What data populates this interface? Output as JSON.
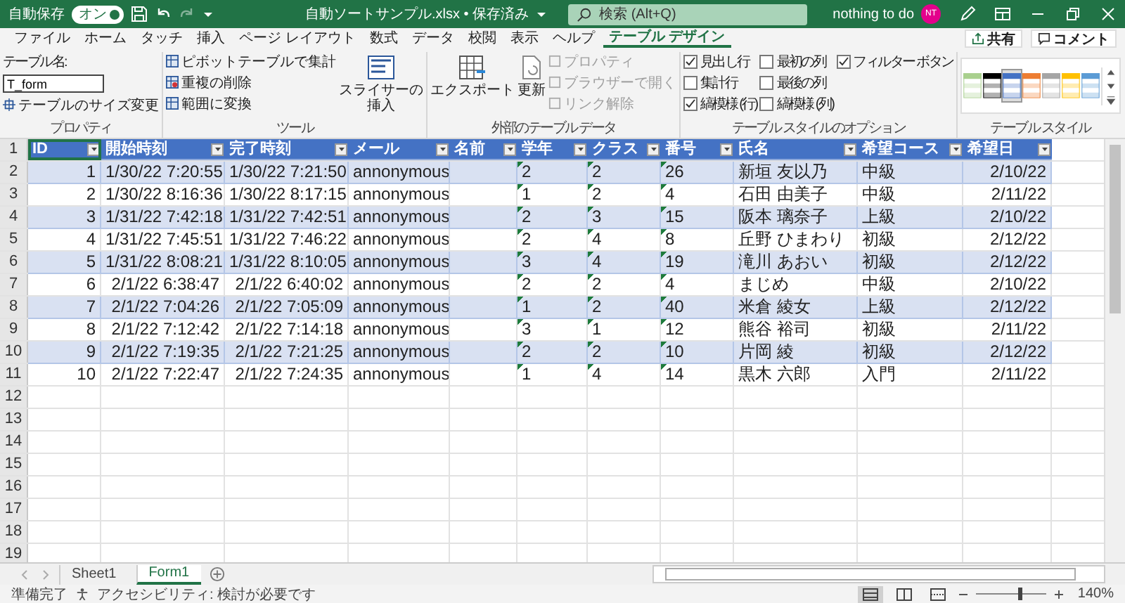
{
  "title_bar": {
    "autosave_label": "自動保存",
    "autosave": {
      "label": "オン",
      "on": true
    },
    "title": "自動ソートサンプル.xlsx • 保存済み",
    "search_placeholder": "検索 (Alt+Q)",
    "user": "nothing to do",
    "avatar": "NT"
  },
  "ribbon_tabs": [
    {
      "label": "ファイル",
      "selected": false
    },
    {
      "label": "ホーム",
      "selected": false
    },
    {
      "label": "タッチ",
      "selected": false
    },
    {
      "label": "挿入",
      "selected": false
    },
    {
      "label": "ページ レイアウト",
      "selected": false
    },
    {
      "label": "数式",
      "selected": false
    },
    {
      "label": "データ",
      "selected": false
    },
    {
      "label": "校閲",
      "selected": false
    },
    {
      "label": "表示",
      "selected": false
    },
    {
      "label": "ヘルプ",
      "selected": false
    },
    {
      "label": "テーブル デザイン",
      "selected": true
    }
  ],
  "share": "共有",
  "comment": "コメント",
  "properties": {
    "name_label": "テーブル名:",
    "name_value": "T_form",
    "resize": "テーブルのサイズ変更",
    "label": "プロパティ"
  },
  "tools": {
    "items": [
      "ピボットテーブルで集計",
      "重複の削除",
      "範囲に変換"
    ],
    "slicer_lines": [
      "スライサーの",
      "挿入"
    ],
    "label": "ツール"
  },
  "external": {
    "export": "エクスポート",
    "refresh": "更新",
    "links": [
      {
        "label": "プロパティ",
        "disabled": true
      },
      {
        "label": "ブラウザーで開く",
        "disabled": true
      },
      {
        "label": "リンク解除",
        "disabled": true
      }
    ],
    "label": "外部のテーブル データ"
  },
  "style_options": {
    "options": [
      {
        "label": "見出し行",
        "checked": true
      },
      {
        "label": "集計行",
        "checked": false
      },
      {
        "label": "縞模様 (行)",
        "checked": true
      },
      {
        "label": "最初の列",
        "checked": false
      },
      {
        "label": "最後の列",
        "checked": false
      },
      {
        "label": "縞模様 (列)",
        "checked": false
      },
      {
        "label": "フィルター ボタン",
        "checked": true
      }
    ],
    "label": "テーブル スタイルのオプション"
  },
  "table_styles": {
    "swatches": [
      {
        "color": "#a9d08e",
        "selected": false
      },
      {
        "color": "#000000",
        "selected": false
      },
      {
        "color": "#4472c4",
        "selected": true
      },
      {
        "color": "#ed7d31",
        "selected": false
      },
      {
        "color": "#a5a5a5",
        "selected": false
      },
      {
        "color": "#ffc000",
        "selected": false
      },
      {
        "color": "#5b9bd5",
        "selected": false
      }
    ],
    "label": "テーブル スタイル"
  },
  "sheet": {
    "header_row_number": "1",
    "columns": [
      {
        "label": "ID",
        "text_number": false
      },
      {
        "label": "開始時刻",
        "text_number": false
      },
      {
        "label": "完了時刻",
        "text_number": false
      },
      {
        "label": "メール",
        "text_number": false
      },
      {
        "label": "名前",
        "text_number": false
      },
      {
        "label": "学年",
        "text_number": true
      },
      {
        "label": "クラス",
        "text_number": true
      },
      {
        "label": "番号",
        "text_number": true
      },
      {
        "label": "氏名",
        "text_number": false
      },
      {
        "label": "希望コース",
        "text_number": false
      },
      {
        "label": "希望日",
        "text_number": false
      }
    ],
    "rows": [
      {
        "row_number": "2",
        "cells": [
          "1",
          "1/30/22 7:20:55",
          "1/30/22 7:21:50",
          "annonymous",
          "",
          "2",
          "2",
          "26",
          "新垣 友以乃",
          "中級",
          "2/10/22"
        ]
      },
      {
        "row_number": "3",
        "cells": [
          "2",
          "1/30/22 8:16:36",
          "1/30/22 8:17:15",
          "annonymous",
          "",
          "1",
          "2",
          "4",
          "石田 由美子",
          "中級",
          "2/11/22"
        ]
      },
      {
        "row_number": "4",
        "cells": [
          "3",
          "1/31/22 7:42:18",
          "1/31/22 7:42:51",
          "annonymous",
          "",
          "2",
          "3",
          "15",
          "阪本 璃奈子",
          "上級",
          "2/10/22"
        ]
      },
      {
        "row_number": "5",
        "cells": [
          "4",
          "1/31/22 7:45:51",
          "1/31/22 7:46:22",
          "annonymous",
          "",
          "2",
          "4",
          "8",
          "丘野 ひまわり",
          "初級",
          "2/12/22"
        ]
      },
      {
        "row_number": "6",
        "cells": [
          "5",
          "1/31/22 8:08:21",
          "1/31/22 8:10:05",
          "annonymous",
          "",
          "3",
          "4",
          "19",
          "滝川 あおい",
          "初級",
          "2/12/22"
        ]
      },
      {
        "row_number": "7",
        "cells": [
          "6",
          "2/1/22 6:38:47",
          "2/1/22 6:40:02",
          "annonymous",
          "",
          "2",
          "2",
          "4",
          "まじめ",
          "中級",
          "2/10/22"
        ]
      },
      {
        "row_number": "8",
        "cells": [
          "7",
          "2/1/22 7:04:26",
          "2/1/22 7:05:09",
          "annonymous",
          "",
          "1",
          "2",
          "40",
          "米倉 綾女",
          "上級",
          "2/12/22"
        ]
      },
      {
        "row_number": "9",
        "cells": [
          "8",
          "2/1/22 7:12:42",
          "2/1/22 7:14:18",
          "annonymous",
          "",
          "3",
          "1",
          "12",
          "熊谷 裕司",
          "初級",
          "2/11/22"
        ]
      },
      {
        "row_number": "10",
        "cells": [
          "9",
          "2/1/22 7:19:35",
          "2/1/22 7:21:25",
          "annonymous",
          "",
          "2",
          "2",
          "10",
          "片岡 綾",
          "初級",
          "2/12/22"
        ]
      },
      {
        "row_number": "11",
        "cells": [
          "10",
          "2/1/22 7:22:47",
          "2/1/22 7:24:35",
          "annonymous",
          "",
          "1",
          "4",
          "14",
          "黒木 六郎",
          "入門",
          "2/11/22"
        ]
      }
    ],
    "empty_row_numbers": [
      "12",
      "13",
      "14",
      "15",
      "16",
      "17",
      "18",
      "19"
    ]
  },
  "sheet_tabs": [
    {
      "label": "Sheet1",
      "selected": false
    },
    {
      "label": "Form1",
      "selected": true
    }
  ],
  "status_bar": {
    "ready": "準備完了",
    "accessibility": "アクセシビリティ: 検討が必要です",
    "views": [
      {
        "kind": "normal",
        "selected": true
      },
      {
        "kind": "page_layout",
        "selected": false
      },
      {
        "kind": "page_break",
        "selected": false
      }
    ],
    "zoom": {
      "level": 0.6
    },
    "zoom_label": "140%"
  }
}
